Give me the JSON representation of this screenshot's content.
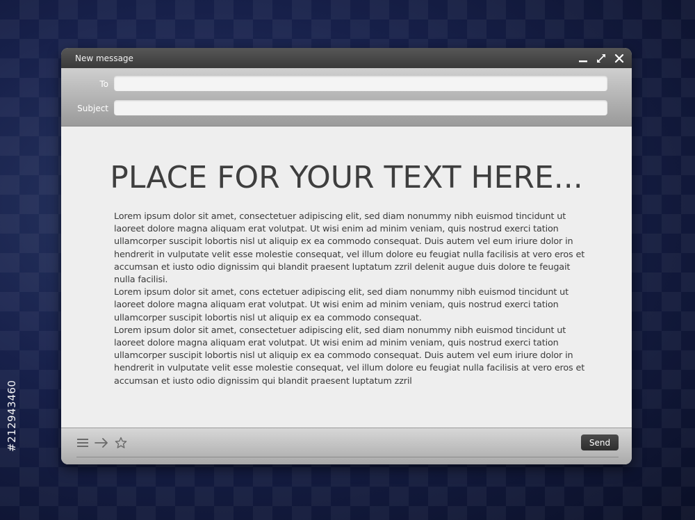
{
  "stock_id": "#212943460",
  "window": {
    "title": "New message"
  },
  "icons": {
    "minimize": "minimize-icon",
    "expand": "expand-icon",
    "close": "close-icon",
    "menu": "menu-icon",
    "forward": "arrow-right-icon",
    "favorite": "star-icon"
  },
  "fields": {
    "to_label": "To",
    "to_value": "",
    "subject_label": "Subject",
    "subject_value": ""
  },
  "body": {
    "headline": "PLACE FOR YOUR TEXT HERE...",
    "paragraphs": [
      "Lorem ipsum dolor sit amet, consectetuer adipiscing elit, sed diam nonummy nibh euismod tincidunt ut laoreet dolore magna aliquam erat volutpat. Ut wisi enim ad minim veniam, quis nostrud exerci tation ullamcorper suscipit lobortis nisl ut aliquip ex ea commodo consequat. Duis autem vel eum iriure dolor in hendrerit in vulputate velit esse molestie consequat, vel illum dolore eu feugiat nulla facilisis at vero eros et accumsan et iusto odio dignissim qui blandit praesent luptatum zzril delenit augue duis dolore te feugait nulla facilisi.",
      "Lorem ipsum dolor sit amet, cons ectetuer adipiscing elit, sed diam nonummy nibh euismod tincidunt ut laoreet dolore magna aliquam erat volutpat. Ut wisi enim ad minim veniam, quis nostrud exerci tation ullamcorper suscipit lobortis nisl ut aliquip ex ea commodo consequat.",
      "Lorem ipsum dolor sit amet, consectetuer adipiscing elit, sed diam nonummy nibh euismod tincidunt ut laoreet dolore magna aliquam erat volutpat. Ut wisi enim ad minim veniam, quis nostrud exerci tation ullamcorper suscipit lobortis nisl ut aliquip ex ea commodo consequat. Duis autem vel eum iriure dolor in hendrerit in vulputate velit esse molestie consequat, vel illum dolore eu feugiat nulla facilisis at vero eros et accumsan et iusto odio dignissim qui blandit praesent luptatum zzril"
    ]
  },
  "footer": {
    "send_label": "Send"
  },
  "colors": {
    "background": "#121a36",
    "titlebar": "#3a3a3a",
    "send_button": "#2e2e2e",
    "text": "#3a3a3a"
  }
}
